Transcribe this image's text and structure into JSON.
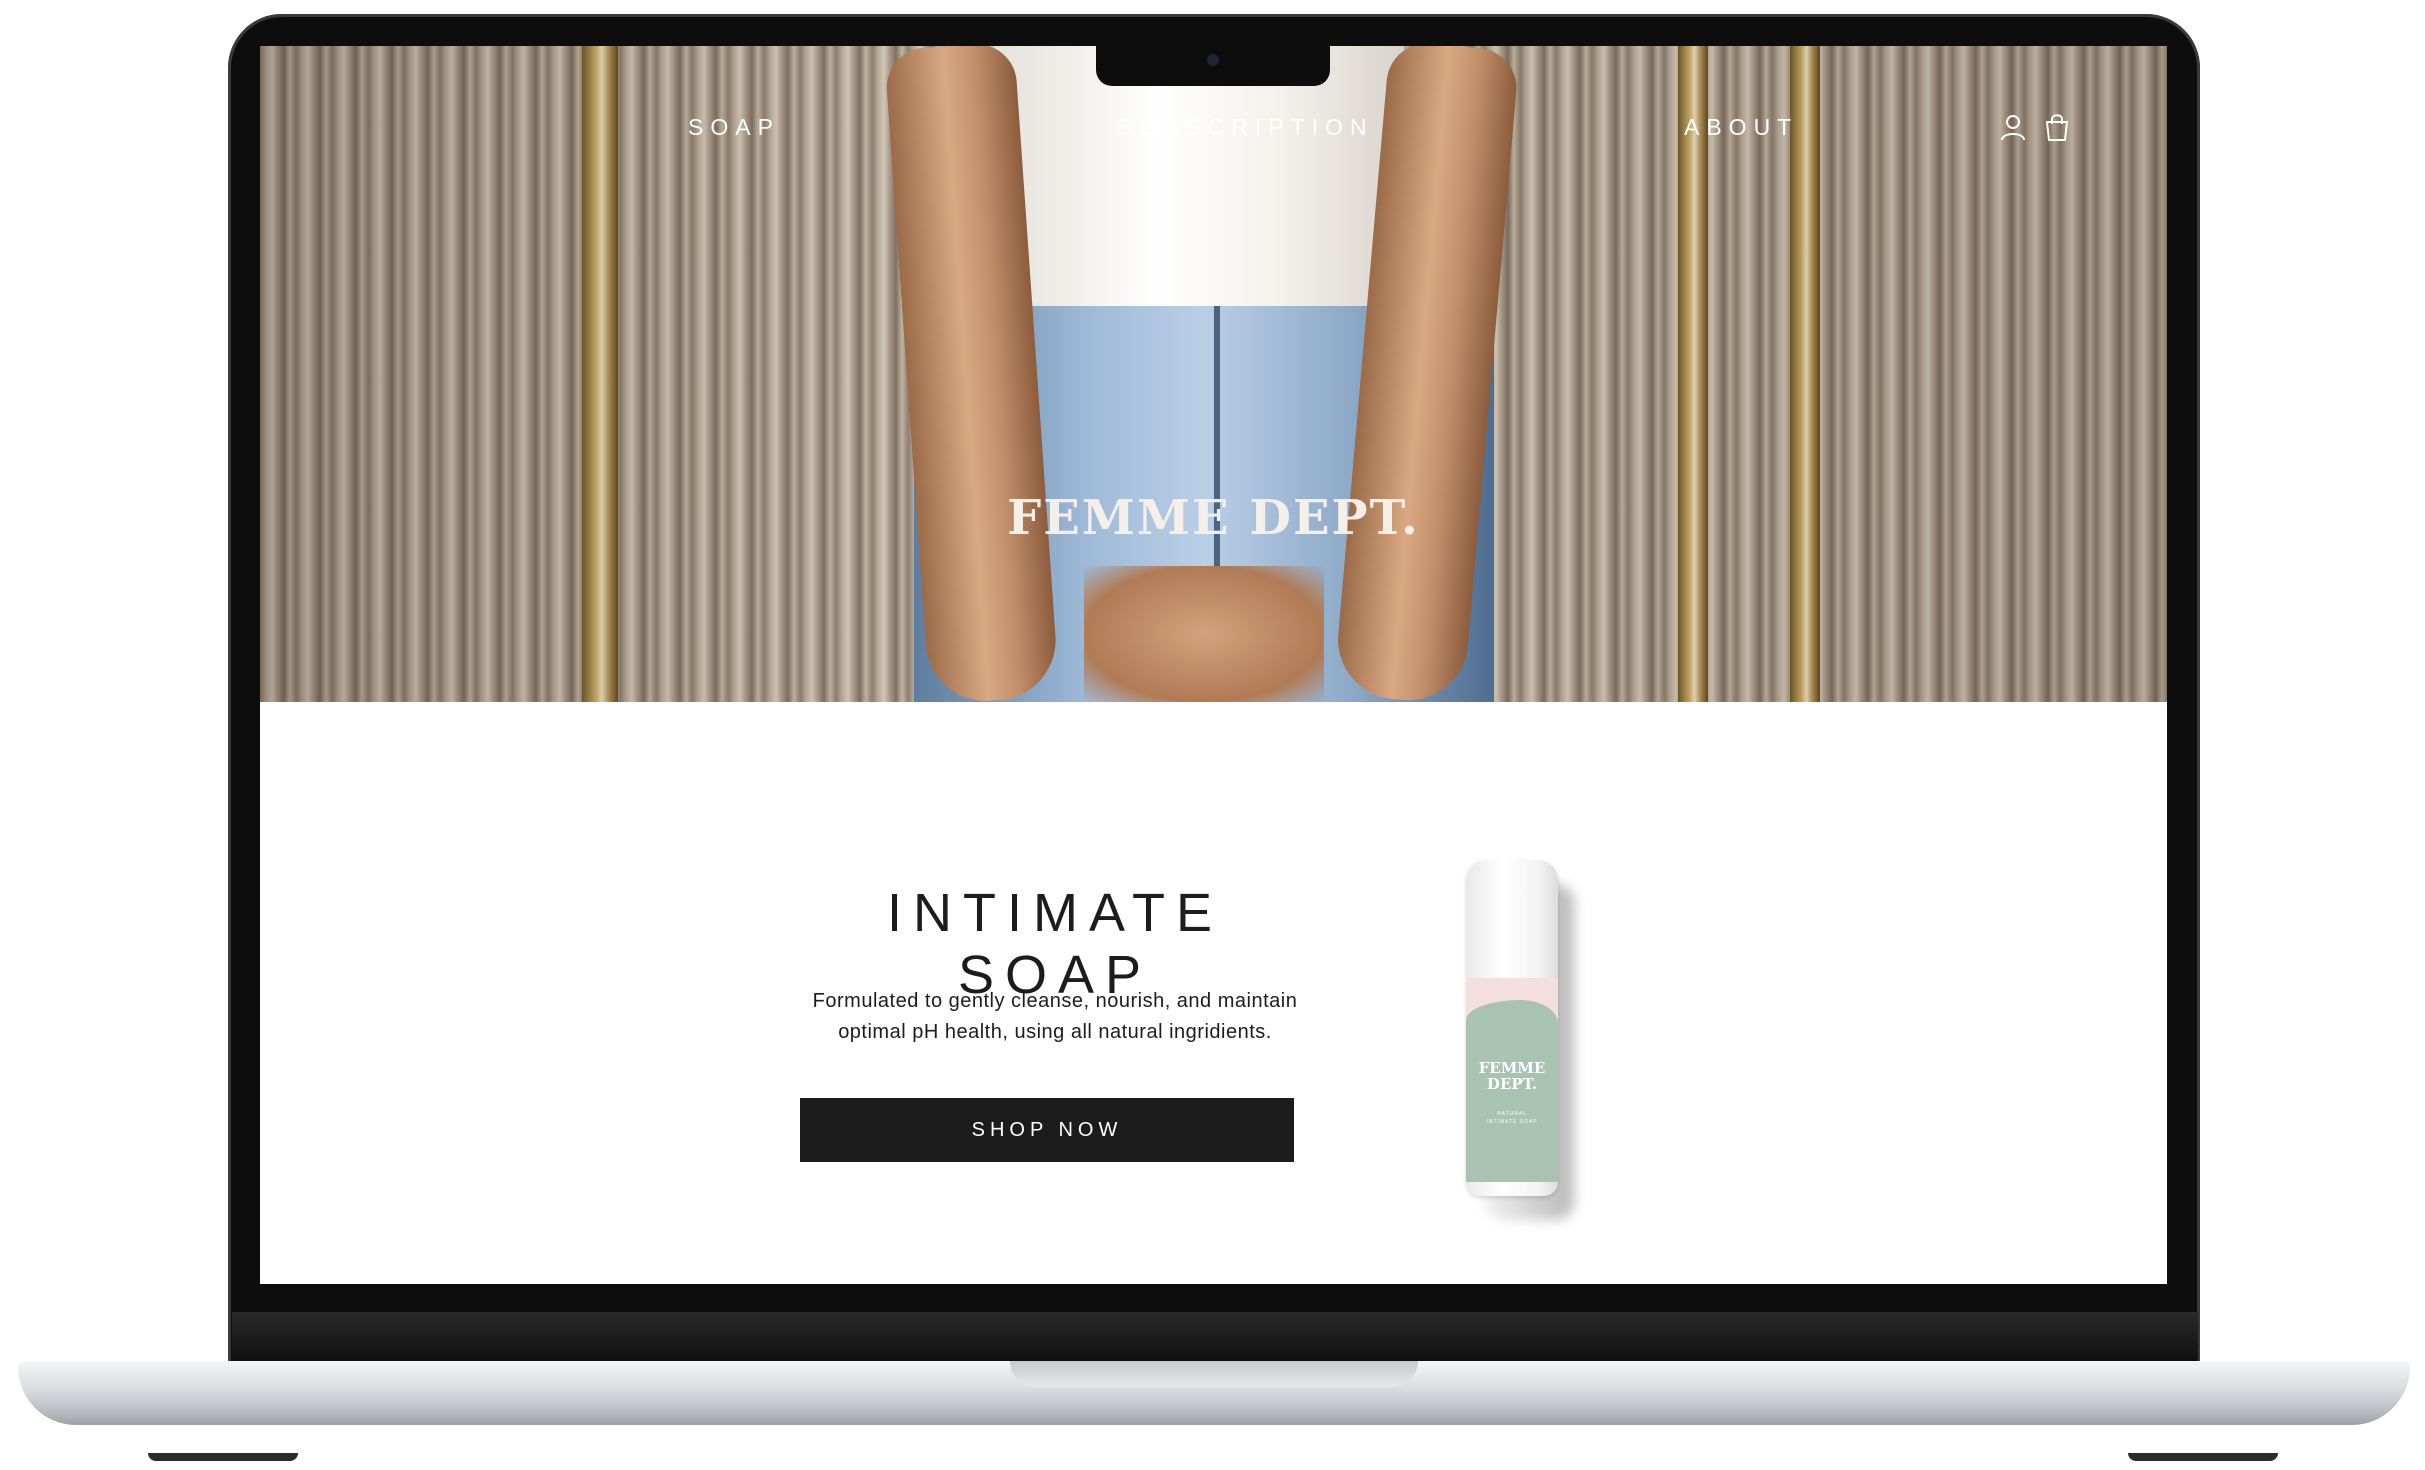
{
  "nav": {
    "soap_label": "SOAP",
    "subscription_label": "SUBSCRIPTION",
    "about_label": "ABOUT",
    "account_icon": "account-icon",
    "cart_icon": "shopping-bag-icon"
  },
  "hero": {
    "logo_text": "FEMME DEPT."
  },
  "product_section": {
    "title": "INTIMATE SOAP",
    "description_line1": "Formulated to gently cleanse, nourish, and maintain",
    "description_line2": "optimal pH health, using all natural ingridients.",
    "cta_label": "SHOP NOW"
  },
  "bottle": {
    "brand_line1": "FEMME",
    "brand_line2": "DEPT.",
    "subtitle_line1": "NATURAL",
    "subtitle_line2": "INTIMATE SOAP"
  },
  "colors": {
    "button_bg": "#1c1c1c",
    "bottle_green": "#a8c3b1",
    "bottle_pink": "#f3dfdd"
  }
}
